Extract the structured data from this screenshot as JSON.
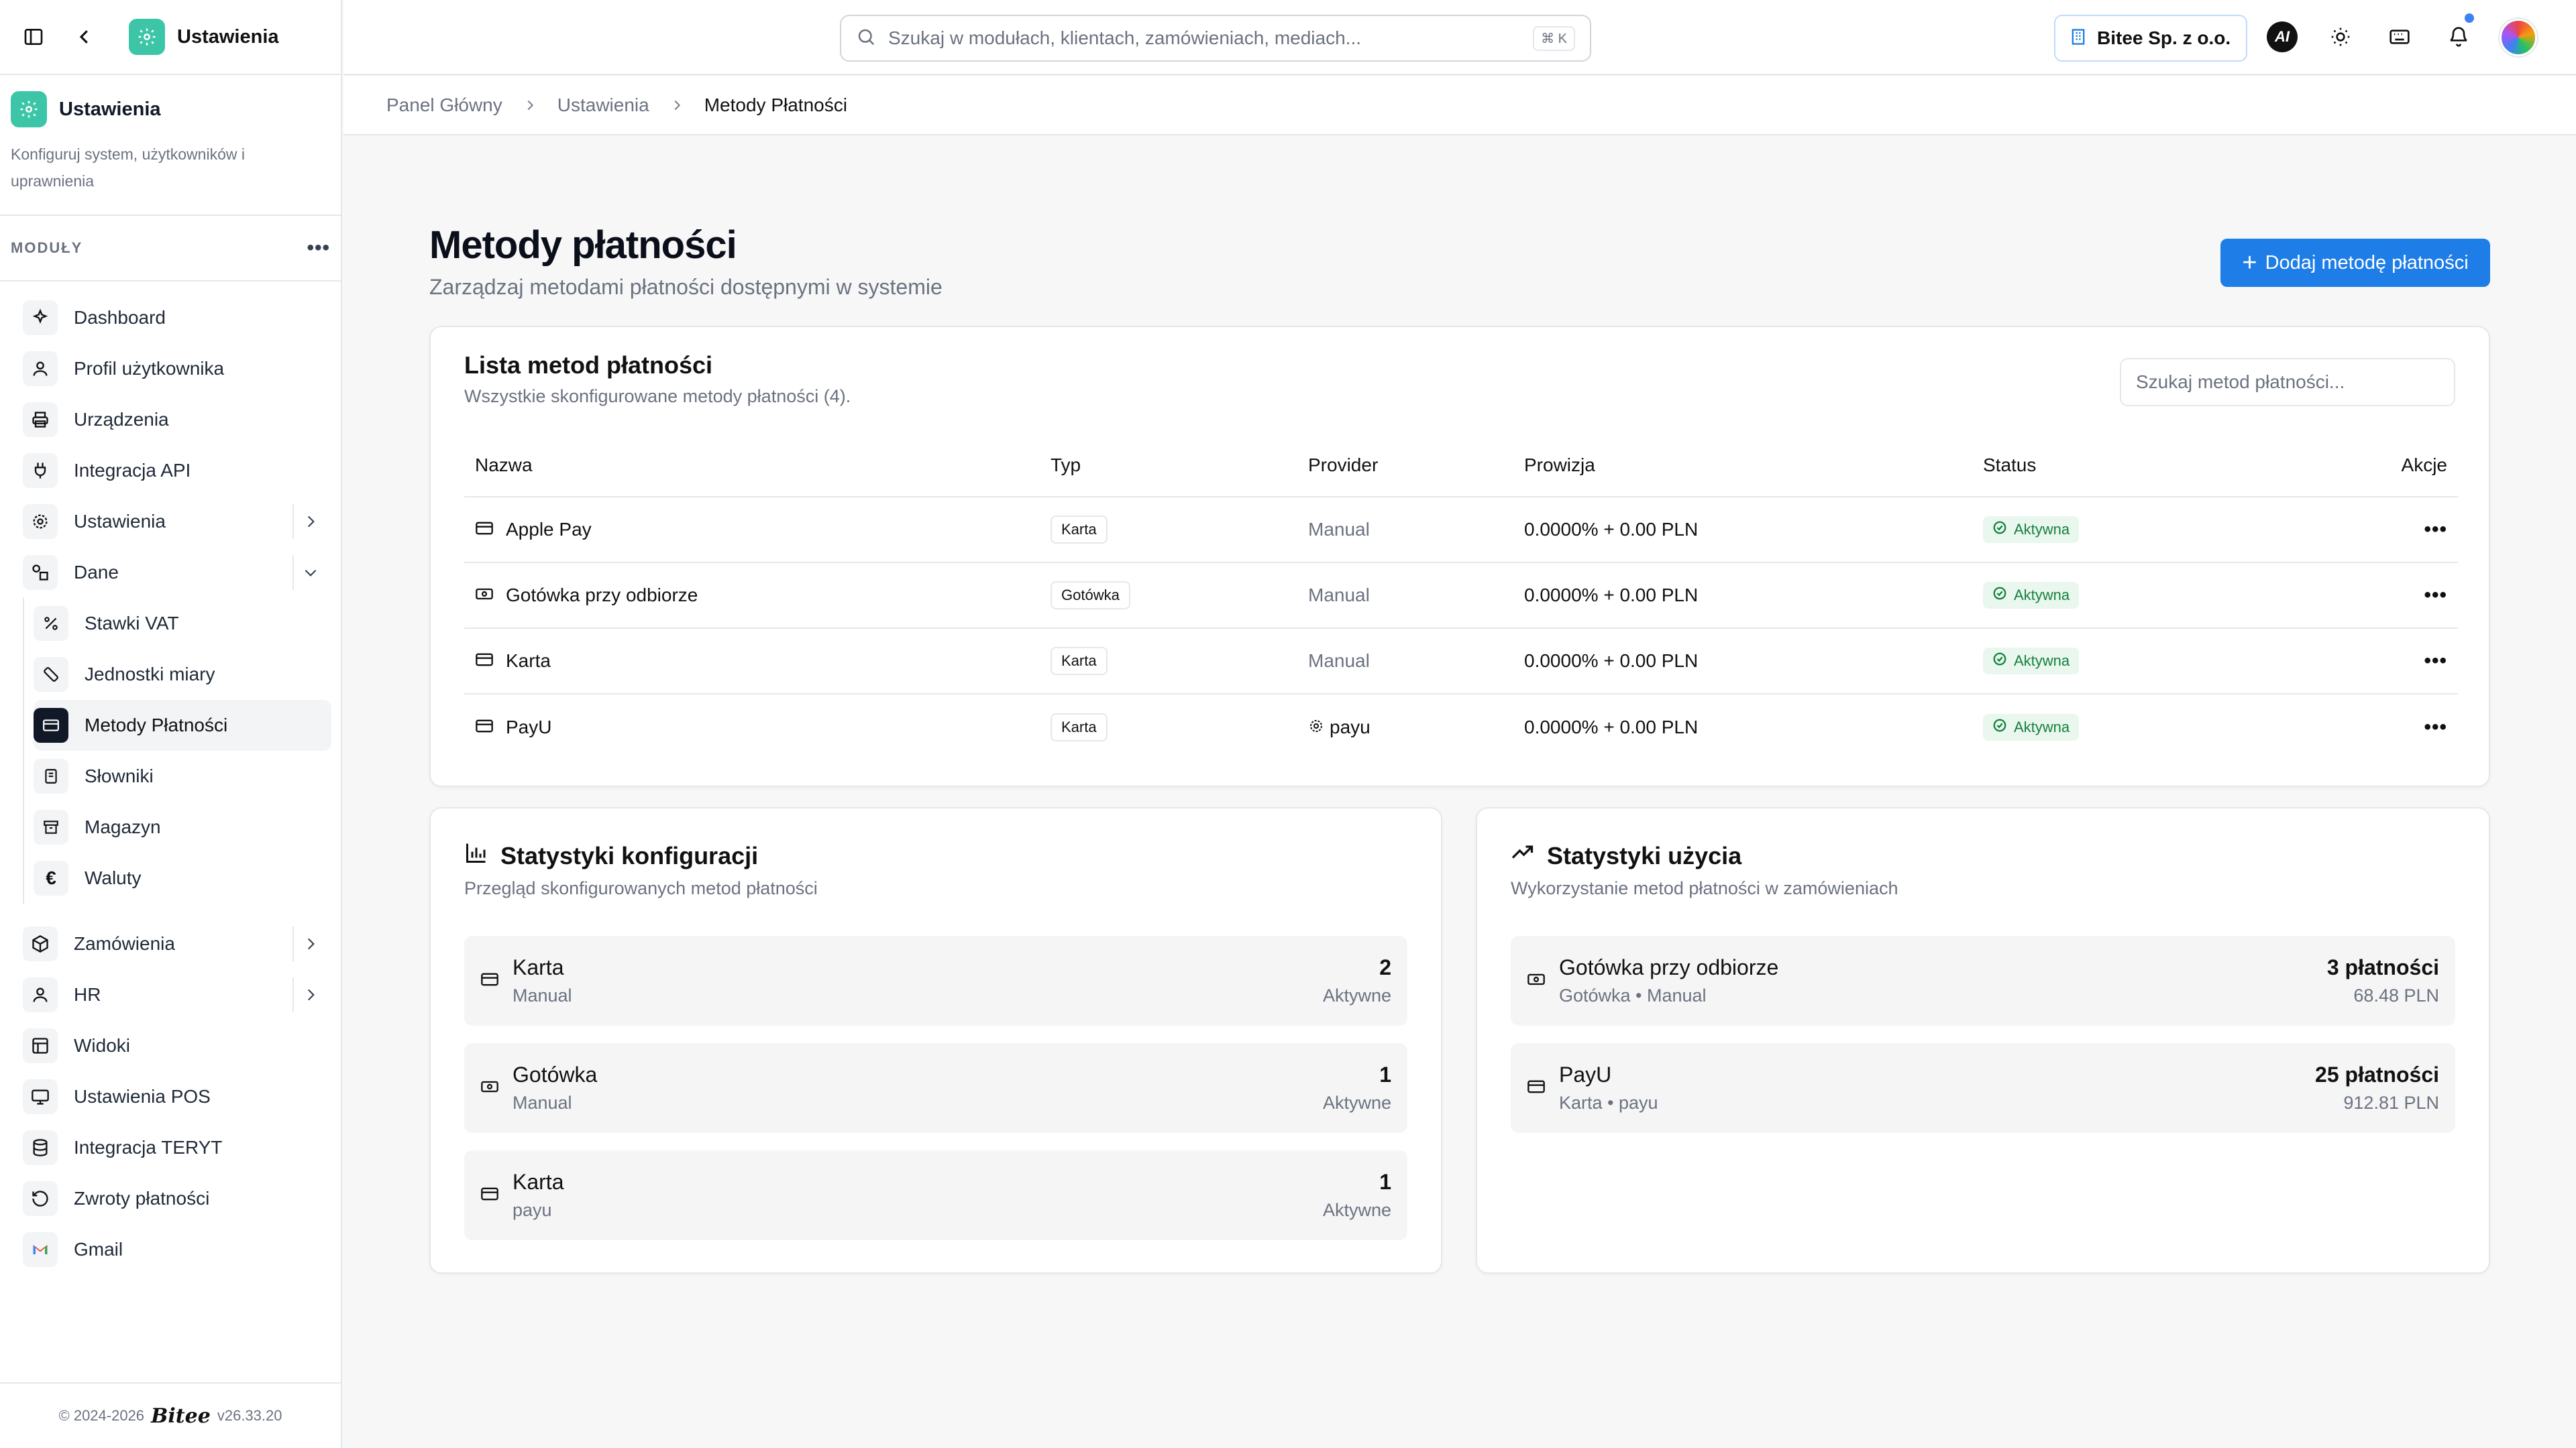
{
  "app": {
    "title": "Ustawienia"
  },
  "sidebar": {
    "header": {
      "title": "Ustawienia",
      "description": "Konfiguruj system, użytkowników i uprawnienia"
    },
    "modules_label": "MODUŁY",
    "items": [
      {
        "label": "Dashboard",
        "icon": "sparkles-icon"
      },
      {
        "label": "Profil użytkownika",
        "icon": "user-icon"
      },
      {
        "label": "Urządzenia",
        "icon": "printer-icon"
      },
      {
        "label": "Integracja API",
        "icon": "plug-icon"
      },
      {
        "label": "Ustawienia",
        "icon": "gear-icon",
        "chevron": "right"
      },
      {
        "label": "Dane",
        "icon": "shapes-icon",
        "chevron": "down"
      }
    ],
    "sub_items": [
      {
        "label": "Stawki VAT",
        "icon": "percent-icon"
      },
      {
        "label": "Jednostki miary",
        "icon": "ruler-icon"
      },
      {
        "label": "Metody Płatności",
        "icon": "credit-card-icon",
        "active": true
      },
      {
        "label": "Słowniki",
        "icon": "book-icon"
      },
      {
        "label": "Magazyn",
        "icon": "archive-icon"
      },
      {
        "label": "Waluty",
        "icon": "euro-icon"
      }
    ],
    "items_after": [
      {
        "label": "Zamówienia",
        "icon": "box-icon",
        "chevron": "right"
      },
      {
        "label": "HR",
        "icon": "user-icon",
        "chevron": "right"
      },
      {
        "label": "Widoki",
        "icon": "layout-icon"
      },
      {
        "label": "Ustawienia POS",
        "icon": "monitor-icon"
      },
      {
        "label": "Integracja TERYT",
        "icon": "database-icon"
      },
      {
        "label": "Zwroty płatności",
        "icon": "rotate-ccw-icon"
      },
      {
        "label": "Gmail",
        "icon": "gmail-icon"
      }
    ],
    "footer": {
      "copyright": "© 2024-2026",
      "brand": "Bitee",
      "version": "v26.33.20"
    }
  },
  "topbar": {
    "search_placeholder": "Szukaj w modułach, klientach, zamówieniach, mediach...",
    "shortcut": "⌘ K",
    "company": "Bitee Sp. z o.o.",
    "ai_label": "AI"
  },
  "breadcrumb": [
    "Panel Główny",
    "Ustawienia",
    "Metody Płatności"
  ],
  "page": {
    "title": "Metody płatności",
    "subtitle": "Zarządzaj metodami płatności dostępnymi w systemie",
    "add_button": "Dodaj metodę płatności"
  },
  "list": {
    "title": "Lista metod płatności",
    "description": "Wszystkie skonfigurowane metody płatności (4).",
    "search_placeholder": "Szukaj metod płatności...",
    "columns": [
      "Nazwa",
      "Typ",
      "Provider",
      "Prowizja",
      "Status",
      "Akcje"
    ],
    "rows": [
      {
        "name": "Apple Pay",
        "icon": "credit-card-icon",
        "type": "Karta",
        "provider": "Manual",
        "fee": "0.0000% + 0.00 PLN",
        "status": "Aktywna"
      },
      {
        "name": "Gotówka przy odbiorze",
        "icon": "banknote-icon",
        "type": "Gotówka",
        "provider": "Manual",
        "fee": "0.0000% + 0.00 PLN",
        "status": "Aktywna"
      },
      {
        "name": "Karta",
        "icon": "credit-card-icon",
        "type": "Karta",
        "provider": "Manual",
        "fee": "0.0000% + 0.00 PLN",
        "status": "Aktywna"
      },
      {
        "name": "PayU",
        "icon": "credit-card-icon",
        "type": "Karta",
        "provider": "payu",
        "provider_icon": "gear-icon",
        "fee": "0.0000% + 0.00 PLN",
        "status": "Aktywna"
      }
    ]
  },
  "config_stats": {
    "title": "Statystyki konfiguracji",
    "description": "Przegląd skonfigurowanych metod płatności",
    "items": [
      {
        "title": "Karta",
        "sub": "Manual",
        "value": "2",
        "unit": "Aktywne",
        "icon": "credit-card-icon"
      },
      {
        "title": "Gotówka",
        "sub": "Manual",
        "value": "1",
        "unit": "Aktywne",
        "icon": "banknote-icon"
      },
      {
        "title": "Karta",
        "sub": "payu",
        "value": "1",
        "unit": "Aktywne",
        "icon": "credit-card-icon"
      }
    ]
  },
  "usage_stats": {
    "title": "Statystyki użycia",
    "description": "Wykorzystanie metod płatności w zamówieniach",
    "items": [
      {
        "title": "Gotówka przy odbiorze",
        "sub": "Gotówka • Manual",
        "value": "3 płatności",
        "unit": "68.48 PLN",
        "icon": "banknote-icon"
      },
      {
        "title": "PayU",
        "sub": "Karta • payu",
        "value": "25 płatności",
        "unit": "912.81 PLN",
        "icon": "credit-card-icon"
      }
    ]
  },
  "colors": {
    "accent": "#1e7de6",
    "brand": "#3cc5a6",
    "status_active": "#15803d"
  }
}
